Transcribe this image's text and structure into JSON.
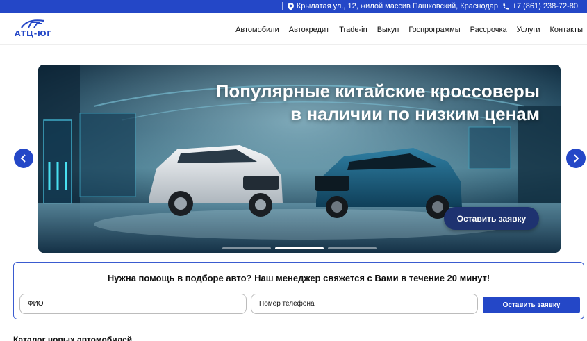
{
  "topbar": {
    "address": "Крылатая ул., 12, жилой массив Пашковский, Краснодар",
    "phone": "+7 (861) 238-72-80"
  },
  "header": {
    "logo_text": "АТЦ-ЮГ",
    "nav": [
      "Автомобили",
      "Автокредит",
      "Trade-in",
      "Выкуп",
      "Госпрограммы",
      "Рассрочка",
      "Услуги",
      "Контакты"
    ]
  },
  "hero": {
    "title_line1": "Популярные китайские кроссоверы",
    "title_line2": "в наличии по низким ценам",
    "cta_label": "Оставить заявку",
    "slides_count": 3,
    "active_slide": 2
  },
  "lead_form": {
    "title": "Нужна помощь в подборе авто? Наш менеджер свяжется с Вами в течение 20 минут!",
    "name_placeholder": "ФИО",
    "phone_placeholder": "Номер телефона",
    "submit_label": "Оставить заявку"
  },
  "next_section": {
    "heading": "Каталог новых автомобилей"
  },
  "colors": {
    "brand_blue": "#2447c7",
    "cta_dark": "#1e3270"
  },
  "icons": {
    "location": "location-pin-icon",
    "phone": "phone-icon",
    "prev": "chevron-left-icon",
    "next": "chevron-right-icon"
  }
}
